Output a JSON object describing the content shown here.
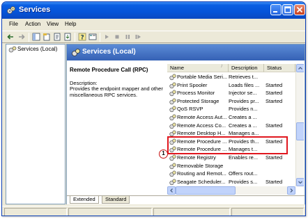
{
  "window": {
    "title": "Services",
    "colors": {
      "titlebar": "#0553d8",
      "header": "#4a78c9",
      "highlight": "#e0161e"
    }
  },
  "menu": {
    "items": [
      "File",
      "Action",
      "View",
      "Help"
    ]
  },
  "toolbar": {
    "icons": [
      "back-arrow-icon",
      "forward-arrow-icon",
      "console-tree-icon",
      "properties-icon",
      "refresh-icon",
      "export-list-icon",
      "help-icon",
      "view-icon",
      "start-icon",
      "stop-icon",
      "pause-icon",
      "restart-icon"
    ]
  },
  "tree": {
    "root_label": "Services (Local)"
  },
  "panel": {
    "title": "Services (Local)"
  },
  "details": {
    "service_name": "Remote Procedure Call (RPC)",
    "description_label": "Description:",
    "description_text": "Provides the endpoint mapper and other miscellaneous RPC services."
  },
  "list": {
    "columns": {
      "name": "Name",
      "sort_indicator": "/",
      "description": "Description",
      "status": "Status"
    },
    "rows": [
      {
        "name": "Portable Media Seri...",
        "description": "Retrieves t...",
        "status": ""
      },
      {
        "name": "Print Spooler",
        "description": "Loads files ...",
        "status": "Started"
      },
      {
        "name": "Process Monitor",
        "description": "Injector se...",
        "status": "Started"
      },
      {
        "name": "Protected Storage",
        "description": "Provides pr...",
        "status": "Started"
      },
      {
        "name": "QoS RSVP",
        "description": "Provides n...",
        "status": ""
      },
      {
        "name": "Remote Access Aut...",
        "description": "Creates a ...",
        "status": ""
      },
      {
        "name": "Remote Access Co...",
        "description": "Creates a ...",
        "status": "Started"
      },
      {
        "name": "Remote Desktop H...",
        "description": "Manages a...",
        "status": ""
      },
      {
        "name": "Remote Procedure ...",
        "description": "Provides th...",
        "status": "Started"
      },
      {
        "name": "Remote Procedure ...",
        "description": "Manages t...",
        "status": ""
      },
      {
        "name": "Remote Registry",
        "description": "Enables re...",
        "status": "Started"
      },
      {
        "name": "Removable Storage",
        "description": "",
        "status": ""
      },
      {
        "name": "Routing and Remot...",
        "description": "Offers rout...",
        "status": ""
      },
      {
        "name": "Seagate Scheduler...",
        "description": "Provides s...",
        "status": "Started"
      }
    ]
  },
  "annotation": {
    "callout_number": "1"
  },
  "tabs": {
    "extended": "Extended",
    "standard": "Standard"
  }
}
